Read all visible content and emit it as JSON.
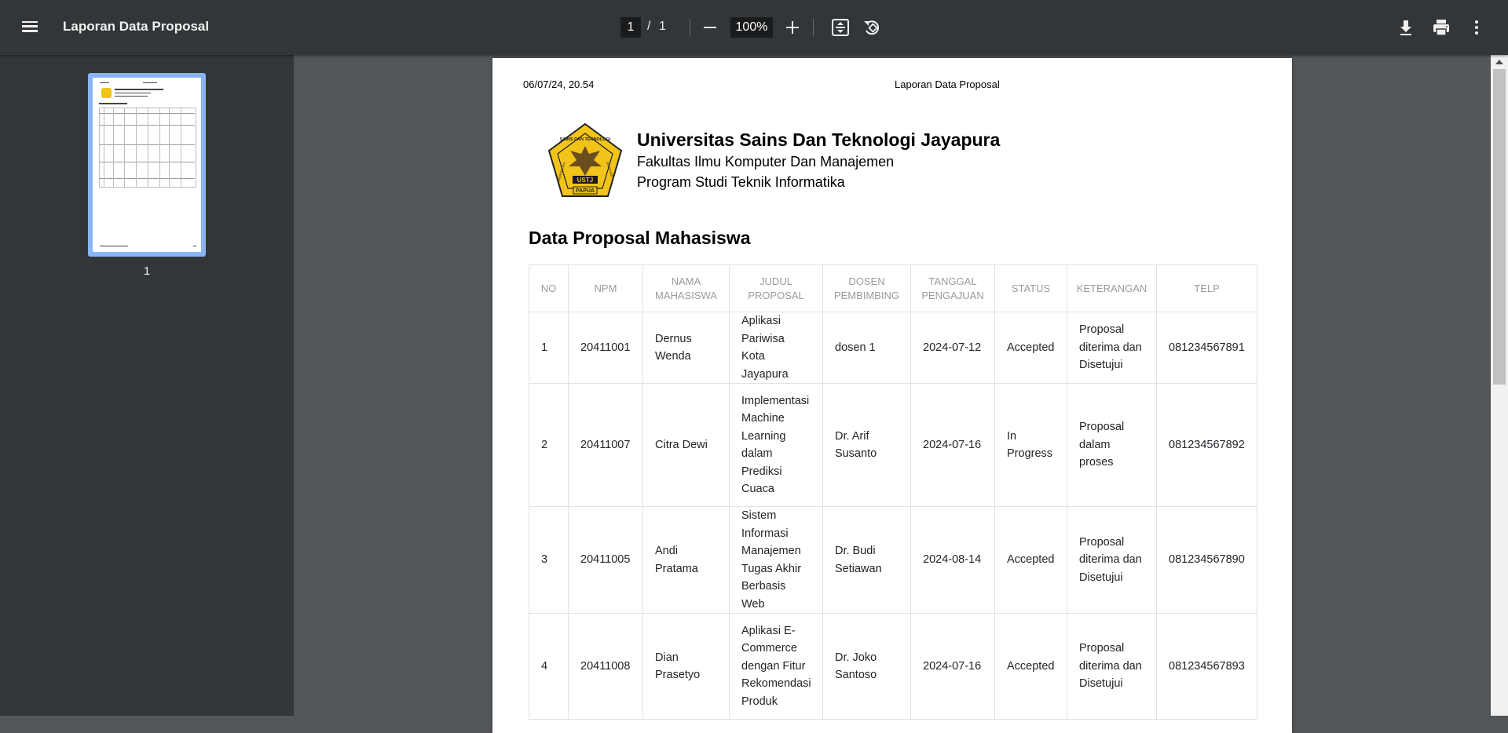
{
  "toolbar": {
    "title": "Laporan Data Proposal",
    "page_current": "1",
    "page_separator": "/",
    "page_total": "1",
    "zoom": "100%"
  },
  "sidebar": {
    "thumbnail_label": "1"
  },
  "page": {
    "header_date": "06/07/24, 20.54",
    "header_title": "Laporan Data Proposal",
    "logo_text_top": "SAINS DAN TEKNOLOGI",
    "logo_text_left": "UNIVERSITAS",
    "logo_text_right": "JAYAPURA",
    "logo_text_ustj": "USTJ",
    "logo_text_papua": "PAPUA",
    "university": "Universitas Sains Dan Teknologi Jayapura",
    "faculty": "Fakultas Ilmu Komputer Dan Manajemen",
    "program": "Program Studi Teknik Informatika",
    "section_title": "Data Proposal Mahasiswa"
  },
  "table": {
    "headers": [
      "NO",
      "NPM",
      "NAMA MAHASISWA",
      "JUDUL PROPOSAL",
      "DOSEN PEMBIMBING",
      "TANGGAL PENGAJUAN",
      "STATUS",
      "KETERANGAN",
      "TELP"
    ],
    "rows": [
      [
        "1",
        "20411001",
        "Dernus Wenda",
        "Aplikasi Pariwisa Kota Jayapura",
        "dosen 1",
        "2024-07-12",
        "Accepted",
        "Proposal diterima dan Disetujui",
        "081234567891"
      ],
      [
        "2",
        "20411007",
        "Citra Dewi",
        "Implementasi Machine Learning dalam Prediksi Cuaca",
        "Dr. Arif Susanto",
        "2024-07-16",
        "In Progress",
        "Proposal dalam proses",
        "081234567892"
      ],
      [
        "3",
        "20411005",
        "Andi Pratama",
        "Sistem Informasi Manajemen Tugas Akhir Berbasis Web",
        "Dr. Budi Setiawan",
        "2024-08-14",
        "Accepted",
        "Proposal diterima dan Disetujui",
        "081234567890"
      ],
      [
        "4",
        "20411008",
        "Dian Prasetyo",
        "Aplikasi E-Commerce dengan Fitur Rekomendasi Produk",
        "Dr. Joko Santoso",
        "2024-07-16",
        "Accepted",
        "Proposal diterima dan Disetujui",
        "081234567893"
      ]
    ]
  },
  "colors": {
    "toolbar_bg": "#323639",
    "viewer_bg": "#525659",
    "thumb_border": "#8ab4f8",
    "logo_gold": "#f2c318"
  },
  "icons": [
    "menu-icon",
    "zoom-out-icon",
    "zoom-in-icon",
    "fit-page-icon",
    "rotate-icon",
    "download-icon",
    "print-icon",
    "more-vert-icon"
  ]
}
